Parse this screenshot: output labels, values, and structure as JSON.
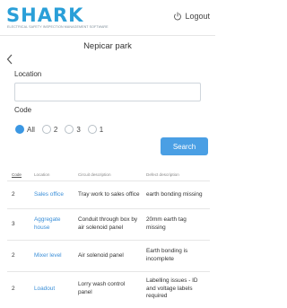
{
  "app": {
    "logo_text": "SHARK",
    "logo_tagline": "ELECTRICAL SAFETY INSPECTION MANAGEMENT SOFTWARE",
    "logout_label": "Logout"
  },
  "page": {
    "title": "Nepicar park"
  },
  "form": {
    "location_label": "Location",
    "location_value": "",
    "location_placeholder": "",
    "code_label": "Code",
    "code_options": [
      {
        "label": "All",
        "checked": true
      },
      {
        "label": "2",
        "checked": false
      },
      {
        "label": "3",
        "checked": false
      },
      {
        "label": "1",
        "checked": false
      }
    ],
    "search_label": "Search"
  },
  "table": {
    "headers": [
      "Code",
      "Location",
      "Circuit description",
      "Defect description"
    ],
    "rows": [
      {
        "code": "2",
        "location": "Sales office",
        "circuit": "Tray work to sales office",
        "defect": "earth bonding missing"
      },
      {
        "code": "3",
        "location": "Aggregate house",
        "circuit": "Conduit through box by air solenoid panel",
        "defect": "20mm earth tag missing"
      },
      {
        "code": "2",
        "location": "Mixer level",
        "circuit": "Air solenoid panel",
        "defect": "Earth bonding is incomplete"
      },
      {
        "code": "2",
        "location": "Loadout",
        "circuit": "Lorry wash control panel",
        "defect": "Labelling issues - ID and voltage labels required"
      }
    ]
  },
  "colors": {
    "brand": "#2a9fd8",
    "accent": "#4a9fe4",
    "link": "#3b8fd8"
  },
  "icons": {
    "logout": "logout-power-icon",
    "back": "chevron-left-icon"
  }
}
